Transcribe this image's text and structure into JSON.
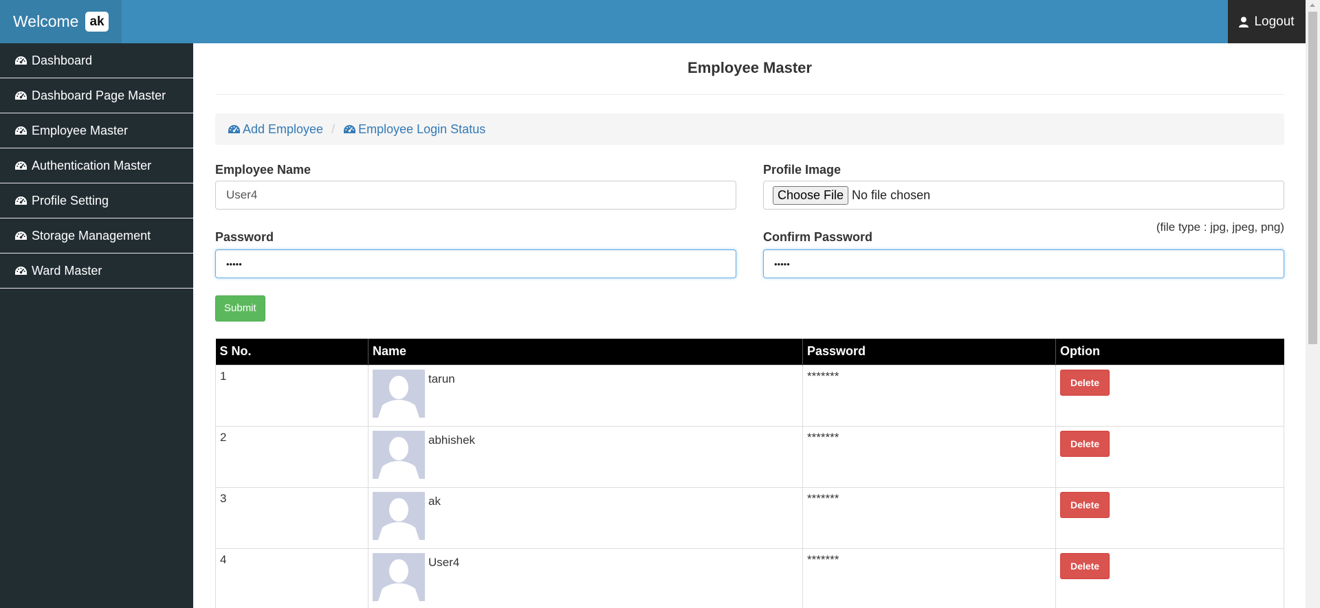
{
  "header": {
    "welcome": "Welcome",
    "user_badge": "ak",
    "logout_label": "Logout"
  },
  "sidebar": {
    "items": [
      {
        "label": "Dashboard"
      },
      {
        "label": "Dashboard Page Master"
      },
      {
        "label": "Employee Master"
      },
      {
        "label": "Authentication Master"
      },
      {
        "label": "Profile Setting"
      },
      {
        "label": "Storage Management"
      },
      {
        "label": "Ward Master"
      }
    ]
  },
  "main": {
    "title": "Employee Master",
    "breadcrumb": {
      "add_employee": "Add Employee",
      "separator": "/",
      "login_status": "Employee Login Status"
    },
    "form": {
      "employee_name_label": "Employee Name",
      "employee_name_value": "User4",
      "profile_image_label": "Profile Image",
      "choose_file_label": "Choose File",
      "no_file_text": "No file chosen",
      "file_hint": "(file type : jpg, jpeg, png)",
      "password_label": "Password",
      "password_value": "•••••",
      "confirm_password_label": "Confirm Password",
      "confirm_password_value": "•••••",
      "submit_label": "Submit"
    },
    "table": {
      "headers": [
        "S No.",
        "Name",
        "Password",
        "Option"
      ],
      "rows": [
        {
          "sno": "1",
          "name": "tarun",
          "password": "*******",
          "action": "Delete"
        },
        {
          "sno": "2",
          "name": "abhishek",
          "password": "*******",
          "action": "Delete"
        },
        {
          "sno": "3",
          "name": "ak",
          "password": "*******",
          "action": "Delete"
        },
        {
          "sno": "4",
          "name": "User4",
          "password": "*******",
          "action": "Delete"
        }
      ]
    }
  },
  "colors": {
    "topbar": "#3c8dbc",
    "brand": "#367fa9",
    "sidebar": "#222d32",
    "submit": "#5cb85c",
    "delete": "#d9534f",
    "link": "#337ab7"
  },
  "icons": {
    "sidebar": "dashboard-icon",
    "logout": "user-icon",
    "avatar": "default-avatar"
  }
}
